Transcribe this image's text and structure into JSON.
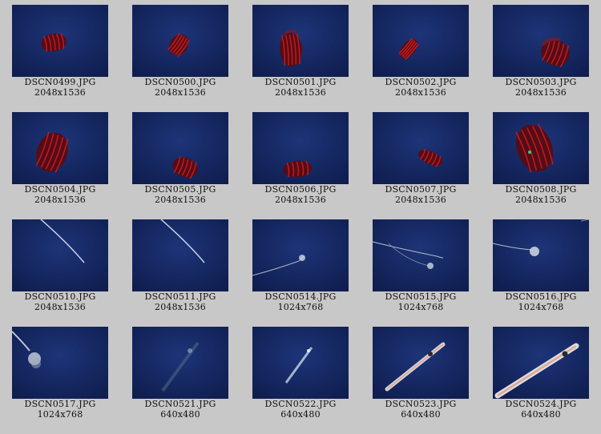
{
  "thumbnails": [
    {
      "filename": "DSCN0499.JPG",
      "dimensions": "2048x1536",
      "scene": "blue-deep",
      "subject": "red-ctenophore-small"
    },
    {
      "filename": "DSCN0500.JPG",
      "dimensions": "2048x1536",
      "scene": "blue-deep",
      "subject": "red-ctenophore-tiny"
    },
    {
      "filename": "DSCN0501.JPG",
      "dimensions": "2048x1536",
      "scene": "blue-medium",
      "subject": "red-ctenophore-upright"
    },
    {
      "filename": "DSCN0502.JPG",
      "dimensions": "2048x1536",
      "scene": "blue-medium",
      "subject": "red-ctenophore-tilted"
    },
    {
      "filename": "DSCN0503.JPG",
      "dimensions": "2048x1536",
      "scene": "blue-medium",
      "subject": "red-ctenophore-large"
    },
    {
      "filename": "DSCN0504.JPG",
      "dimensions": "2048x1536",
      "scene": "blue-medium",
      "subject": "red-ctenophore-left"
    },
    {
      "filename": "DSCN0505.JPG",
      "dimensions": "2048x1536",
      "scene": "blue-dark",
      "subject": "red-ctenophore-bottom"
    },
    {
      "filename": "DSCN0506.JPG",
      "dimensions": "2048x1536",
      "scene": "blue-dark",
      "subject": "red-ctenophore-bottom-left"
    },
    {
      "filename": "DSCN0507.JPG",
      "dimensions": "2048x1536",
      "scene": "blue-medium",
      "subject": "red-ctenophore-flat"
    },
    {
      "filename": "DSCN0508.JPG",
      "dimensions": "2048x1536",
      "scene": "blue-medium",
      "subject": "red-ctenophore-closeup"
    },
    {
      "filename": "DSCN0510.JPG",
      "dimensions": "2048x1536",
      "scene": "blue-light",
      "subject": "white-strand"
    },
    {
      "filename": "DSCN0511.JPG",
      "dimensions": "2048x1536",
      "scene": "blue-light",
      "subject": "white-strand"
    },
    {
      "filename": "DSCN0514.JPG",
      "dimensions": "1024x768",
      "scene": "black",
      "subject": "siphonophore-strand"
    },
    {
      "filename": "DSCN0515.JPG",
      "dimensions": "1024x768",
      "scene": "black",
      "subject": "siphonophore-strand-long"
    },
    {
      "filename": "DSCN0516.JPG",
      "dimensions": "1024x768",
      "scene": "black",
      "subject": "siphonophore-cluster"
    },
    {
      "filename": "DSCN0517.JPG",
      "dimensions": "1024x768",
      "scene": "black",
      "subject": "siphonophore-closeup"
    },
    {
      "filename": "DSCN0521.JPG",
      "dimensions": "640x480",
      "scene": "black",
      "subject": "faint-squid"
    },
    {
      "filename": "DSCN0522.JPG",
      "dimensions": "640x480",
      "scene": "black-blue",
      "subject": "small-squid"
    },
    {
      "filename": "DSCN0523.JPG",
      "dimensions": "640x480",
      "scene": "black",
      "subject": "squid-diagonal"
    },
    {
      "filename": "DSCN0524.JPG",
      "dimensions": "640x480",
      "scene": "blue-deep",
      "subject": "squid-large"
    }
  ],
  "colors": {
    "page_background": "#c8c8c8",
    "text": "#111111",
    "blue_deep": "#0f1d4e",
    "blue_medium": "#1e3f9a",
    "blue_dark": "#0c1538",
    "blue_light": "#3f84dc",
    "black": "#03040a",
    "ctenophore_red": "#c01818"
  }
}
